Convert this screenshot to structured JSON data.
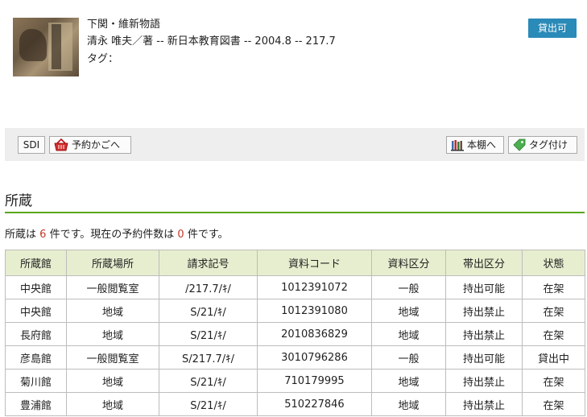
{
  "book": {
    "title": "下関・維新物語",
    "meta": "清永 唯夫／著 -- 新日本教育図書 -- 2004.8 -- 217.7",
    "tag_label": "タグ：",
    "status_badge": "貸出可"
  },
  "toolbar": {
    "sdi_label": "SDI",
    "cart_label": "予約かごへ",
    "shelf_label": "本棚へ",
    "tag_label": "タグ付け"
  },
  "holdings": {
    "section_title": "所蔵",
    "count_prefix": "所蔵は",
    "count_total": "6",
    "count_mid": "件です。現在の予約件数は",
    "count_reserve": "0",
    "count_suffix": "件です。",
    "columns": [
      "所蔵館",
      "所蔵場所",
      "請求記号",
      "資料コード",
      "資料区分",
      "帯出区分",
      "状態"
    ],
    "rows": [
      [
        "中央館",
        "一般閲覧室",
        "/217.7/ｷ/",
        "1012391072",
        "一般",
        "持出可能",
        "在架"
      ],
      [
        "中央館",
        "地域",
        "S/21/ｷ/",
        "1012391080",
        "地域",
        "持出禁止",
        "在架"
      ],
      [
        "長府館",
        "地域",
        "S/21/ｷ/",
        "2010836829",
        "地域",
        "持出禁止",
        "在架"
      ],
      [
        "彦島館",
        "一般閲覧室",
        "S/217.7/ｷ/",
        "3010796286",
        "一般",
        "持出可能",
        "貸出中"
      ],
      [
        "菊川館",
        "地域",
        "S/21/ｷ/",
        "710179995",
        "地域",
        "持出禁止",
        "在架"
      ],
      [
        "豊浦館",
        "地域",
        "S/21/ｷ/",
        "510227846",
        "地域",
        "持出禁止",
        "在架"
      ]
    ]
  },
  "colors": {
    "accent_green": "#5aa51a",
    "header_bg": "#e6eecf",
    "badge_blue": "#2a8ab8",
    "count_red": "#c0392b"
  }
}
